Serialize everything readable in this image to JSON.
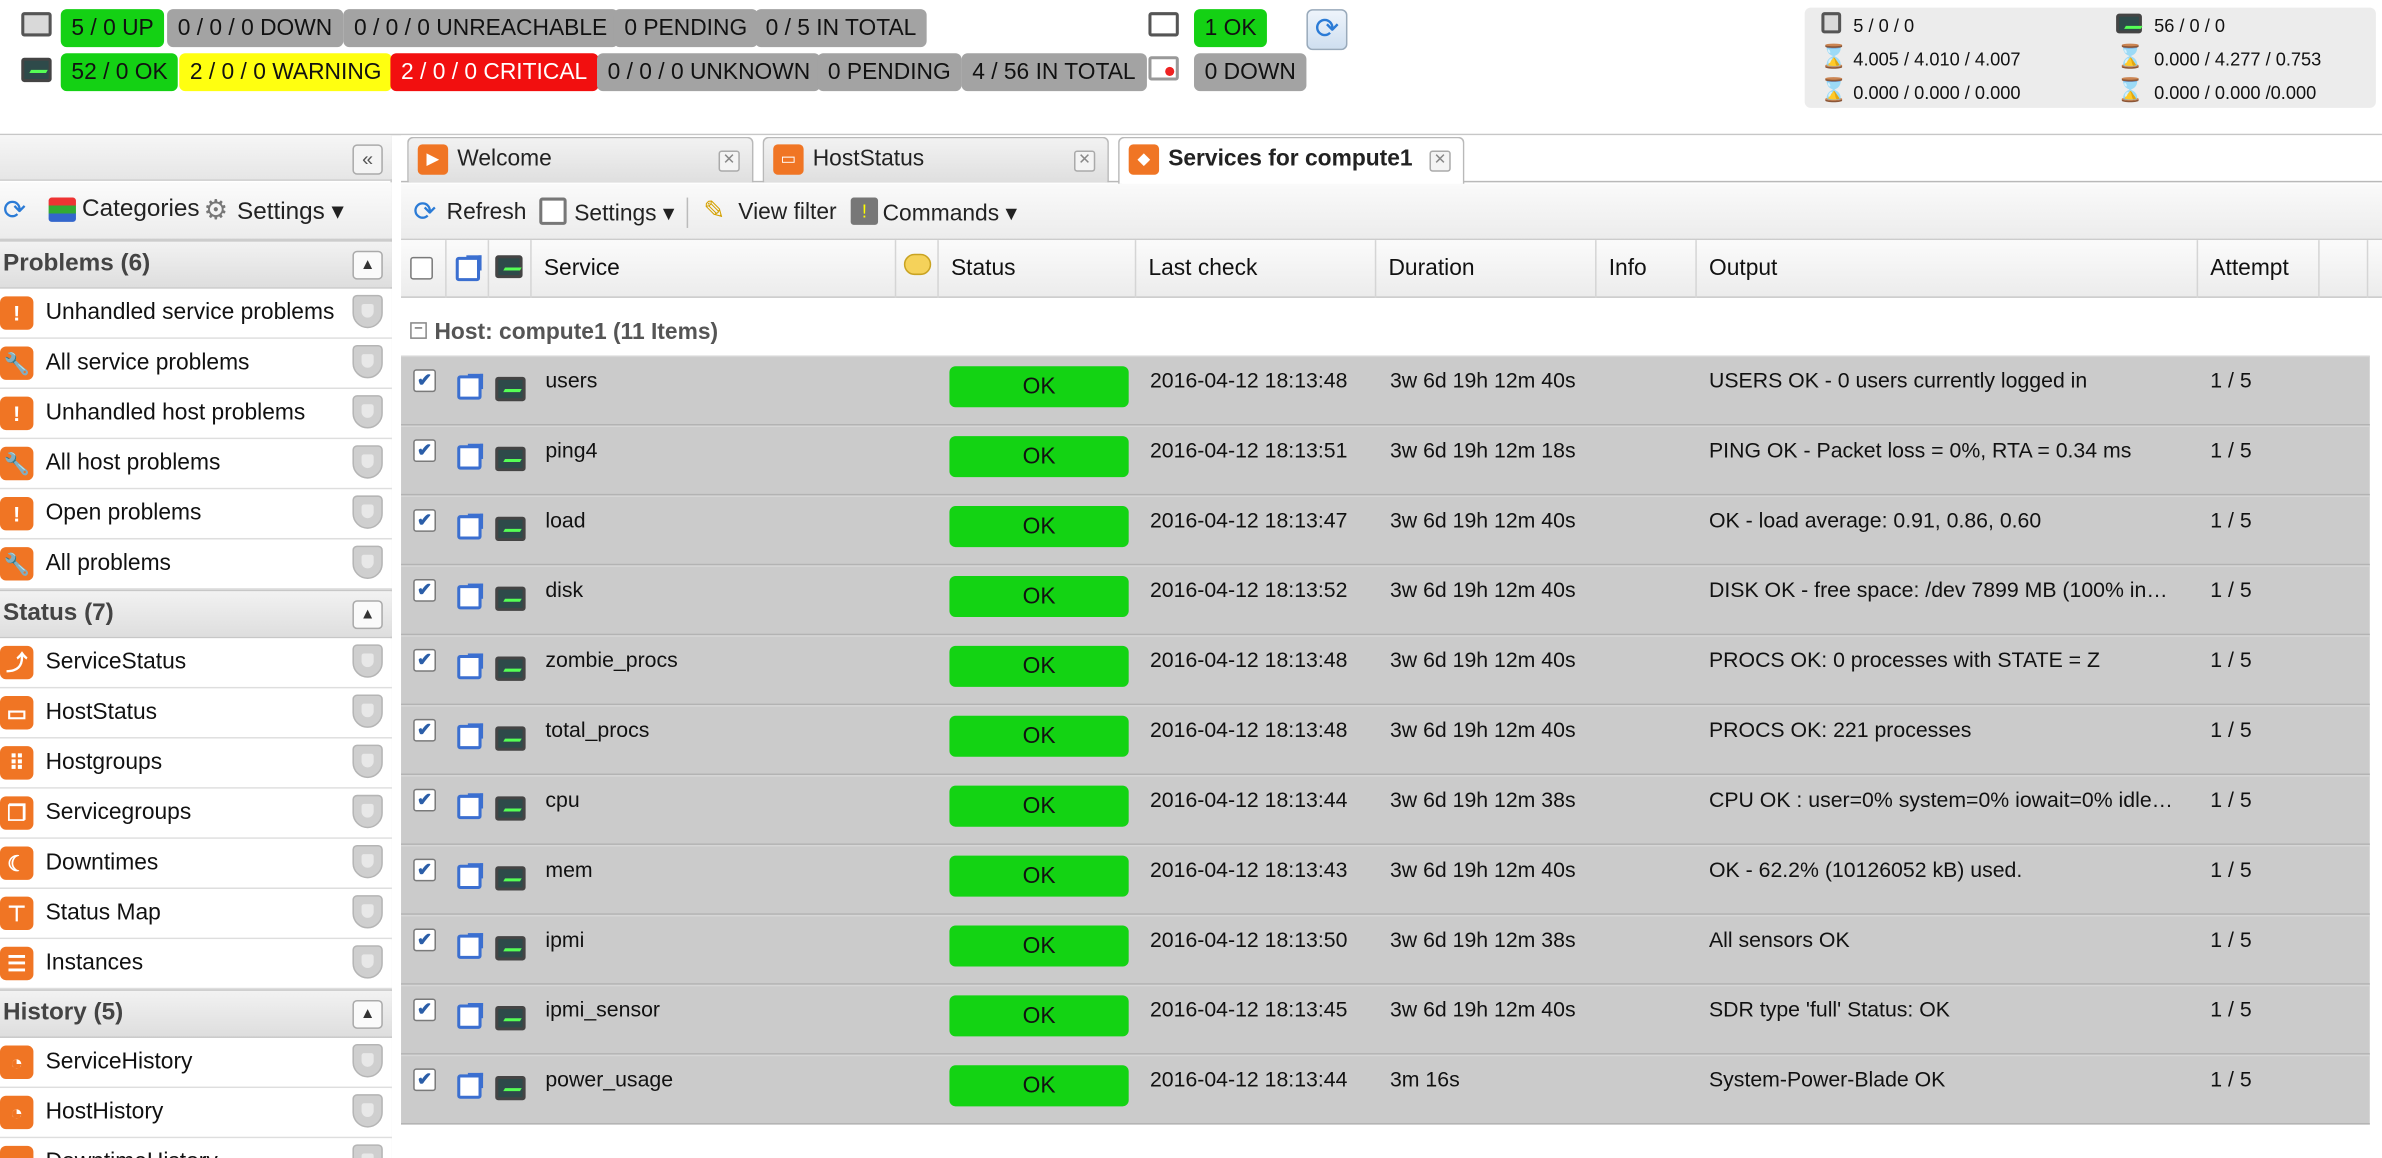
{
  "header": {
    "host_row": [
      {
        "text": "5 / 0 UP",
        "color": "#14d114"
      },
      {
        "text": "0 / 0 / 0 DOWN",
        "color": "#a3a3a3"
      },
      {
        "text": "0 / 0 / 0 UNREACHABLE",
        "color": "#a3a3a3"
      },
      {
        "text": "0 PENDING",
        "color": "#a3a3a3"
      },
      {
        "text": "0 / 5 IN TOTAL",
        "color": "#a3a3a3"
      }
    ],
    "service_row": [
      {
        "text": "52 / 0 OK",
        "color": "#14d114"
      },
      {
        "text": "2 / 0 / 0 WARNING",
        "color": "#ffff10"
      },
      {
        "text": "2 / 0 / 0 CRITICAL",
        "color": "#f20f0f"
      },
      {
        "text": "0 / 0 / 0 UNKNOWN",
        "color": "#a3a3a3"
      },
      {
        "text": "0 PENDING",
        "color": "#a3a3a3"
      },
      {
        "text": "4 / 56 IN TOTAL",
        "color": "#a3a3a3"
      }
    ],
    "monitor_ok": "1 OK",
    "monitor_down": "0 DOWN",
    "stats": {
      "hosts": "5 / 0 / 0",
      "services": "56 / 0 / 0",
      "host_latency": "4.005 / 4.010 / 4.007",
      "service_latency": "0.000 / 4.277 / 0.753",
      "host_exec": "0.000 / 0.000 / 0.000",
      "service_exec": "0.000 / 0.000 /0.000"
    }
  },
  "left_panel": {
    "toolbar": {
      "categories": "Categories",
      "settings": "Settings"
    },
    "sections": [
      {
        "title": "Problems (6)",
        "items": [
          "Unhandled service problems",
          "All service problems",
          "Unhandled host problems",
          "All host problems",
          "Open problems",
          "All problems"
        ]
      },
      {
        "title": "Status (7)",
        "items": [
          "ServiceStatus",
          "HostStatus",
          "Hostgroups",
          "Servicegroups",
          "Downtimes",
          "Status Map",
          "Instances"
        ]
      },
      {
        "title": "History (5)",
        "items": [
          "ServiceHistory",
          "HostHistory",
          "DowntimeHistory"
        ]
      }
    ]
  },
  "tabs": [
    {
      "label": "Welcome",
      "icon": "play-icon"
    },
    {
      "label": "HostStatus",
      "icon": "host-icon"
    },
    {
      "label": "Services for compute1",
      "icon": "cube-icon"
    }
  ],
  "toolbar": {
    "refresh": "Refresh",
    "settings": "Settings",
    "view_filter": "View filter",
    "commands": "Commands"
  },
  "grid": {
    "columns": [
      "Service",
      "Status",
      "Last check",
      "Duration",
      "Info",
      "Output",
      "Attempt"
    ],
    "group_label": "Host: compute1 (11 Items)",
    "rows": [
      {
        "service": "users",
        "status": "OK",
        "last_check": "2016-04-12 18:13:48",
        "duration": "3w 6d 19h 12m 40s",
        "output": "USERS OK - 0 users currently logged in",
        "attempt": "1 / 5"
      },
      {
        "service": "ping4",
        "status": "OK",
        "last_check": "2016-04-12 18:13:51",
        "duration": "3w 6d 19h 12m 18s",
        "output": "PING OK - Packet loss = 0%, RTA = 0.34 ms",
        "attempt": "1 / 5"
      },
      {
        "service": "load",
        "status": "OK",
        "last_check": "2016-04-12 18:13:47",
        "duration": "3w 6d 19h 12m 40s",
        "output": "OK - load average: 0.91, 0.86, 0.60",
        "attempt": "1 / 5"
      },
      {
        "service": "disk",
        "status": "OK",
        "last_check": "2016-04-12 18:13:52",
        "duration": "3w 6d 19h 12m 40s",
        "output": "DISK OK - free space: /dev 7899 MB (100% in…",
        "attempt": "1 / 5"
      },
      {
        "service": "zombie_procs",
        "status": "OK",
        "last_check": "2016-04-12 18:13:48",
        "duration": "3w 6d 19h 12m 40s",
        "output": "PROCS OK: 0 processes with STATE = Z",
        "attempt": "1 / 5"
      },
      {
        "service": "total_procs",
        "status": "OK",
        "last_check": "2016-04-12 18:13:48",
        "duration": "3w 6d 19h 12m 40s",
        "output": "PROCS OK: 221 processes",
        "attempt": "1 / 5"
      },
      {
        "service": "cpu",
        "status": "OK",
        "last_check": "2016-04-12 18:13:44",
        "duration": "3w 6d 19h 12m 38s",
        "output": "CPU OK : user=0% system=0% iowait=0% idle…",
        "attempt": "1 / 5"
      },
      {
        "service": "mem",
        "status": "OK",
        "last_check": "2016-04-12 18:13:43",
        "duration": "3w 6d 19h 12m 40s",
        "output": "OK - 62.2% (10126052 kB) used.",
        "attempt": "1 / 5"
      },
      {
        "service": "ipmi",
        "status": "OK",
        "last_check": "2016-04-12 18:13:50",
        "duration": "3w 6d 19h 12m 38s",
        "output": "All sensors OK",
        "attempt": "1 / 5"
      },
      {
        "service": "ipmi_sensor",
        "status": "OK",
        "last_check": "2016-04-12 18:13:45",
        "duration": "3w 6d 19h 12m 40s",
        "output": "SDR type 'full' Status: OK",
        "attempt": "1 / 5"
      },
      {
        "service": "power_usage",
        "status": "OK",
        "last_check": "2016-04-12 18:13:44",
        "duration": "3m 16s",
        "output": "System-Power-Blade OK",
        "attempt": "1 / 5"
      }
    ]
  }
}
